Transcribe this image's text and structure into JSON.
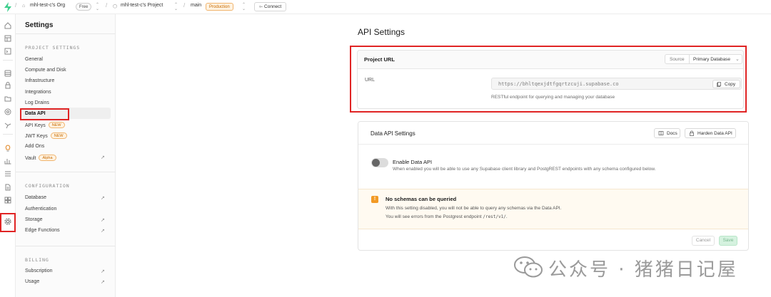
{
  "topbar": {
    "org": "mhl-test-c's Org",
    "org_badge": "Free",
    "project": "mhl-test-c's Project",
    "branch": "main",
    "branch_badge": "Production",
    "connect_label": "Connect"
  },
  "sidebar": {
    "title": "Settings",
    "project_settings_header": "PROJECT SETTINGS",
    "items_project": [
      {
        "label": "General"
      },
      {
        "label": "Compute and Disk"
      },
      {
        "label": "Infrastructure"
      },
      {
        "label": "Integrations"
      },
      {
        "label": "Log Drains"
      },
      {
        "label": "Data API",
        "active": true
      },
      {
        "label": "API Keys",
        "badge": "NEW"
      },
      {
        "label": "JWT Keys",
        "badge": "NEW"
      },
      {
        "label": "Add Ons"
      },
      {
        "label": "Vault",
        "badge": "Alpha",
        "external": true
      }
    ],
    "configuration_header": "CONFIGURATION",
    "items_configuration": [
      {
        "label": "Database",
        "external": true
      },
      {
        "label": "Authentication"
      },
      {
        "label": "Storage",
        "external": true
      },
      {
        "label": "Edge Functions",
        "external": true
      }
    ],
    "billing_header": "BILLING",
    "items_billing": [
      {
        "label": "Subscription",
        "external": true
      },
      {
        "label": "Usage",
        "external": true
      }
    ],
    "external_glyph": "↗"
  },
  "main": {
    "title": "API Settings",
    "project_url": {
      "title": "Project URL",
      "source_label": "Source",
      "source_value": "Primary Database",
      "url_label": "URL",
      "url_value": "https://bhltqexjdtfgqrtzcuji.supabase.co",
      "copy_label": "Copy",
      "description": "RESTful endpoint for querying and managing your database"
    },
    "data_api": {
      "title": "Data API Settings",
      "docs_label": "Docs",
      "harden_label": "Harden Data API",
      "enable_title": "Enable Data API",
      "enable_desc": "When enabled you will be able to use any Supabase client library and PostgREST endpoints with any schema configured below.",
      "warning_title": "No schemas can be queried",
      "warning_line1": "With this setting disabled, you will not be able to query any schemas via the Data API.",
      "warning_line2_prefix": "You will see errors from the Postgrest endpoint ",
      "warning_line2_code": "/rest/v1/",
      "warning_line2_suffix": ".",
      "cancel_label": "Cancel",
      "save_label": "Save",
      "enabled": false
    }
  },
  "watermark": {
    "text": "公众号 · 猪猪日记屋"
  },
  "colors": {
    "highlight_red": "#e02424",
    "badge_orange": "#c76a00",
    "warning_orange": "#f29a25",
    "save_green": "#d5f2df"
  }
}
